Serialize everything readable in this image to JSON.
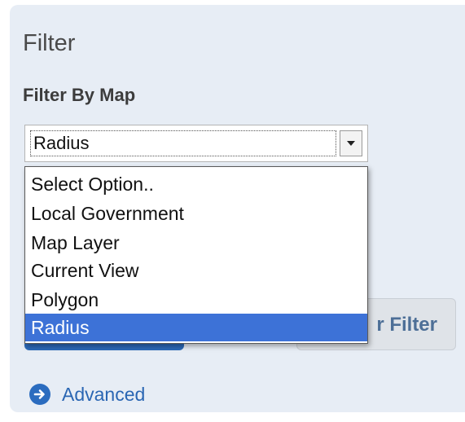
{
  "panel": {
    "title": "Filter"
  },
  "filter_by_map": {
    "label": "Filter By Map",
    "select": {
      "value": "Radius",
      "options": [
        "Select Option..",
        "Local Government",
        "Map Layer",
        "Current View",
        "Polygon",
        "Radius"
      ],
      "selected_option": "Radius"
    }
  },
  "buttons": {
    "right_partial_label": "r Filter"
  },
  "advanced_link": {
    "label": "Advanced",
    "icon": "arrow-circle-right-icon"
  },
  "colors": {
    "panel_bg": "#e7edf5",
    "selected_bg": "#3d72d7",
    "primary_blue": "#2b69b8",
    "link_blue": "#2a66b3"
  }
}
